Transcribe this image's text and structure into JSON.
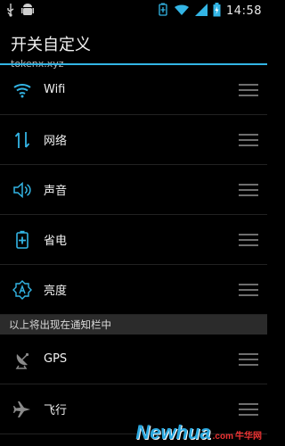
{
  "status_bar": {
    "time": "14:58",
    "left_icons": [
      "usb-icon",
      "android-icon"
    ],
    "right_icons": [
      "battery-saver-icon",
      "wifi-signal-icon",
      "cell-signal-icon",
      "battery-charging-icon"
    ]
  },
  "header": {
    "title": "开关自定义",
    "subtitle": "tokenx.xyz"
  },
  "accent_color": "#33b5e5",
  "items": [
    {
      "label": "Wifi",
      "icon": "wifi-icon"
    },
    {
      "label": "网络",
      "icon": "mobile-data-icon"
    },
    {
      "label": "声音",
      "icon": "sound-icon"
    },
    {
      "label": "省电",
      "icon": "battery-saver-icon"
    },
    {
      "label": "亮度",
      "icon": "brightness-icon"
    }
  ],
  "section_header": "以上将出现在通知栏中",
  "more_items": [
    {
      "label": "GPS",
      "icon": "gps-icon"
    },
    {
      "label": "飞行",
      "icon": "airplane-icon"
    }
  ],
  "watermark": {
    "brand": "Newhua",
    "domain": ".com",
    "cn": "牛华网"
  }
}
